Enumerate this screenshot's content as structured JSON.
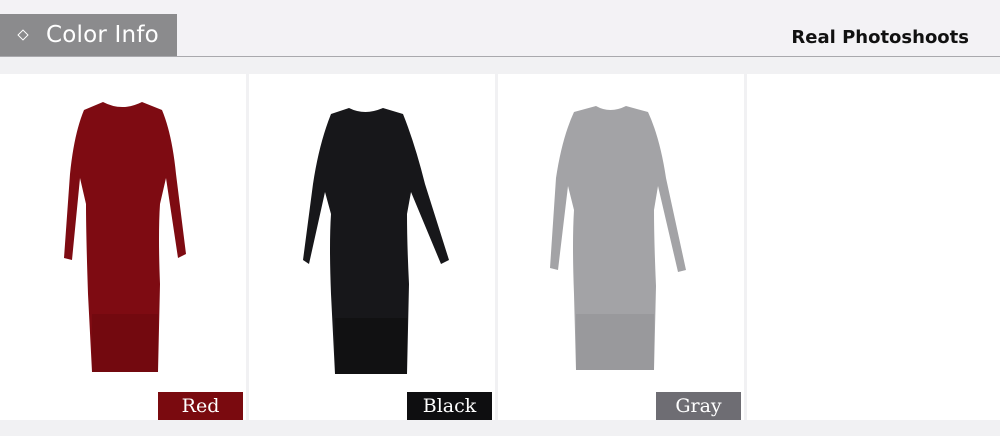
{
  "header": {
    "title": "Color Info",
    "title_icon": "diamond-icon",
    "subtitle": "Real Photoshoots"
  },
  "colors": [
    {
      "label": "Red",
      "dress_color": "#7e0b12",
      "shade_color": "#5f060b",
      "label_bg": "#7a0a0f"
    },
    {
      "label": "Black",
      "dress_color": "#17171a",
      "shade_color": "#050507",
      "label_bg": "#0e0e10"
    },
    {
      "label": "Gray",
      "dress_color": "#a3a3a6",
      "shade_color": "#86868a",
      "label_bg": "#6e6d73"
    }
  ],
  "theme": {
    "header_bg": "#f3f2f5",
    "tab_bg": "#8b8b8d",
    "band_bg": "#f1f1f3"
  }
}
